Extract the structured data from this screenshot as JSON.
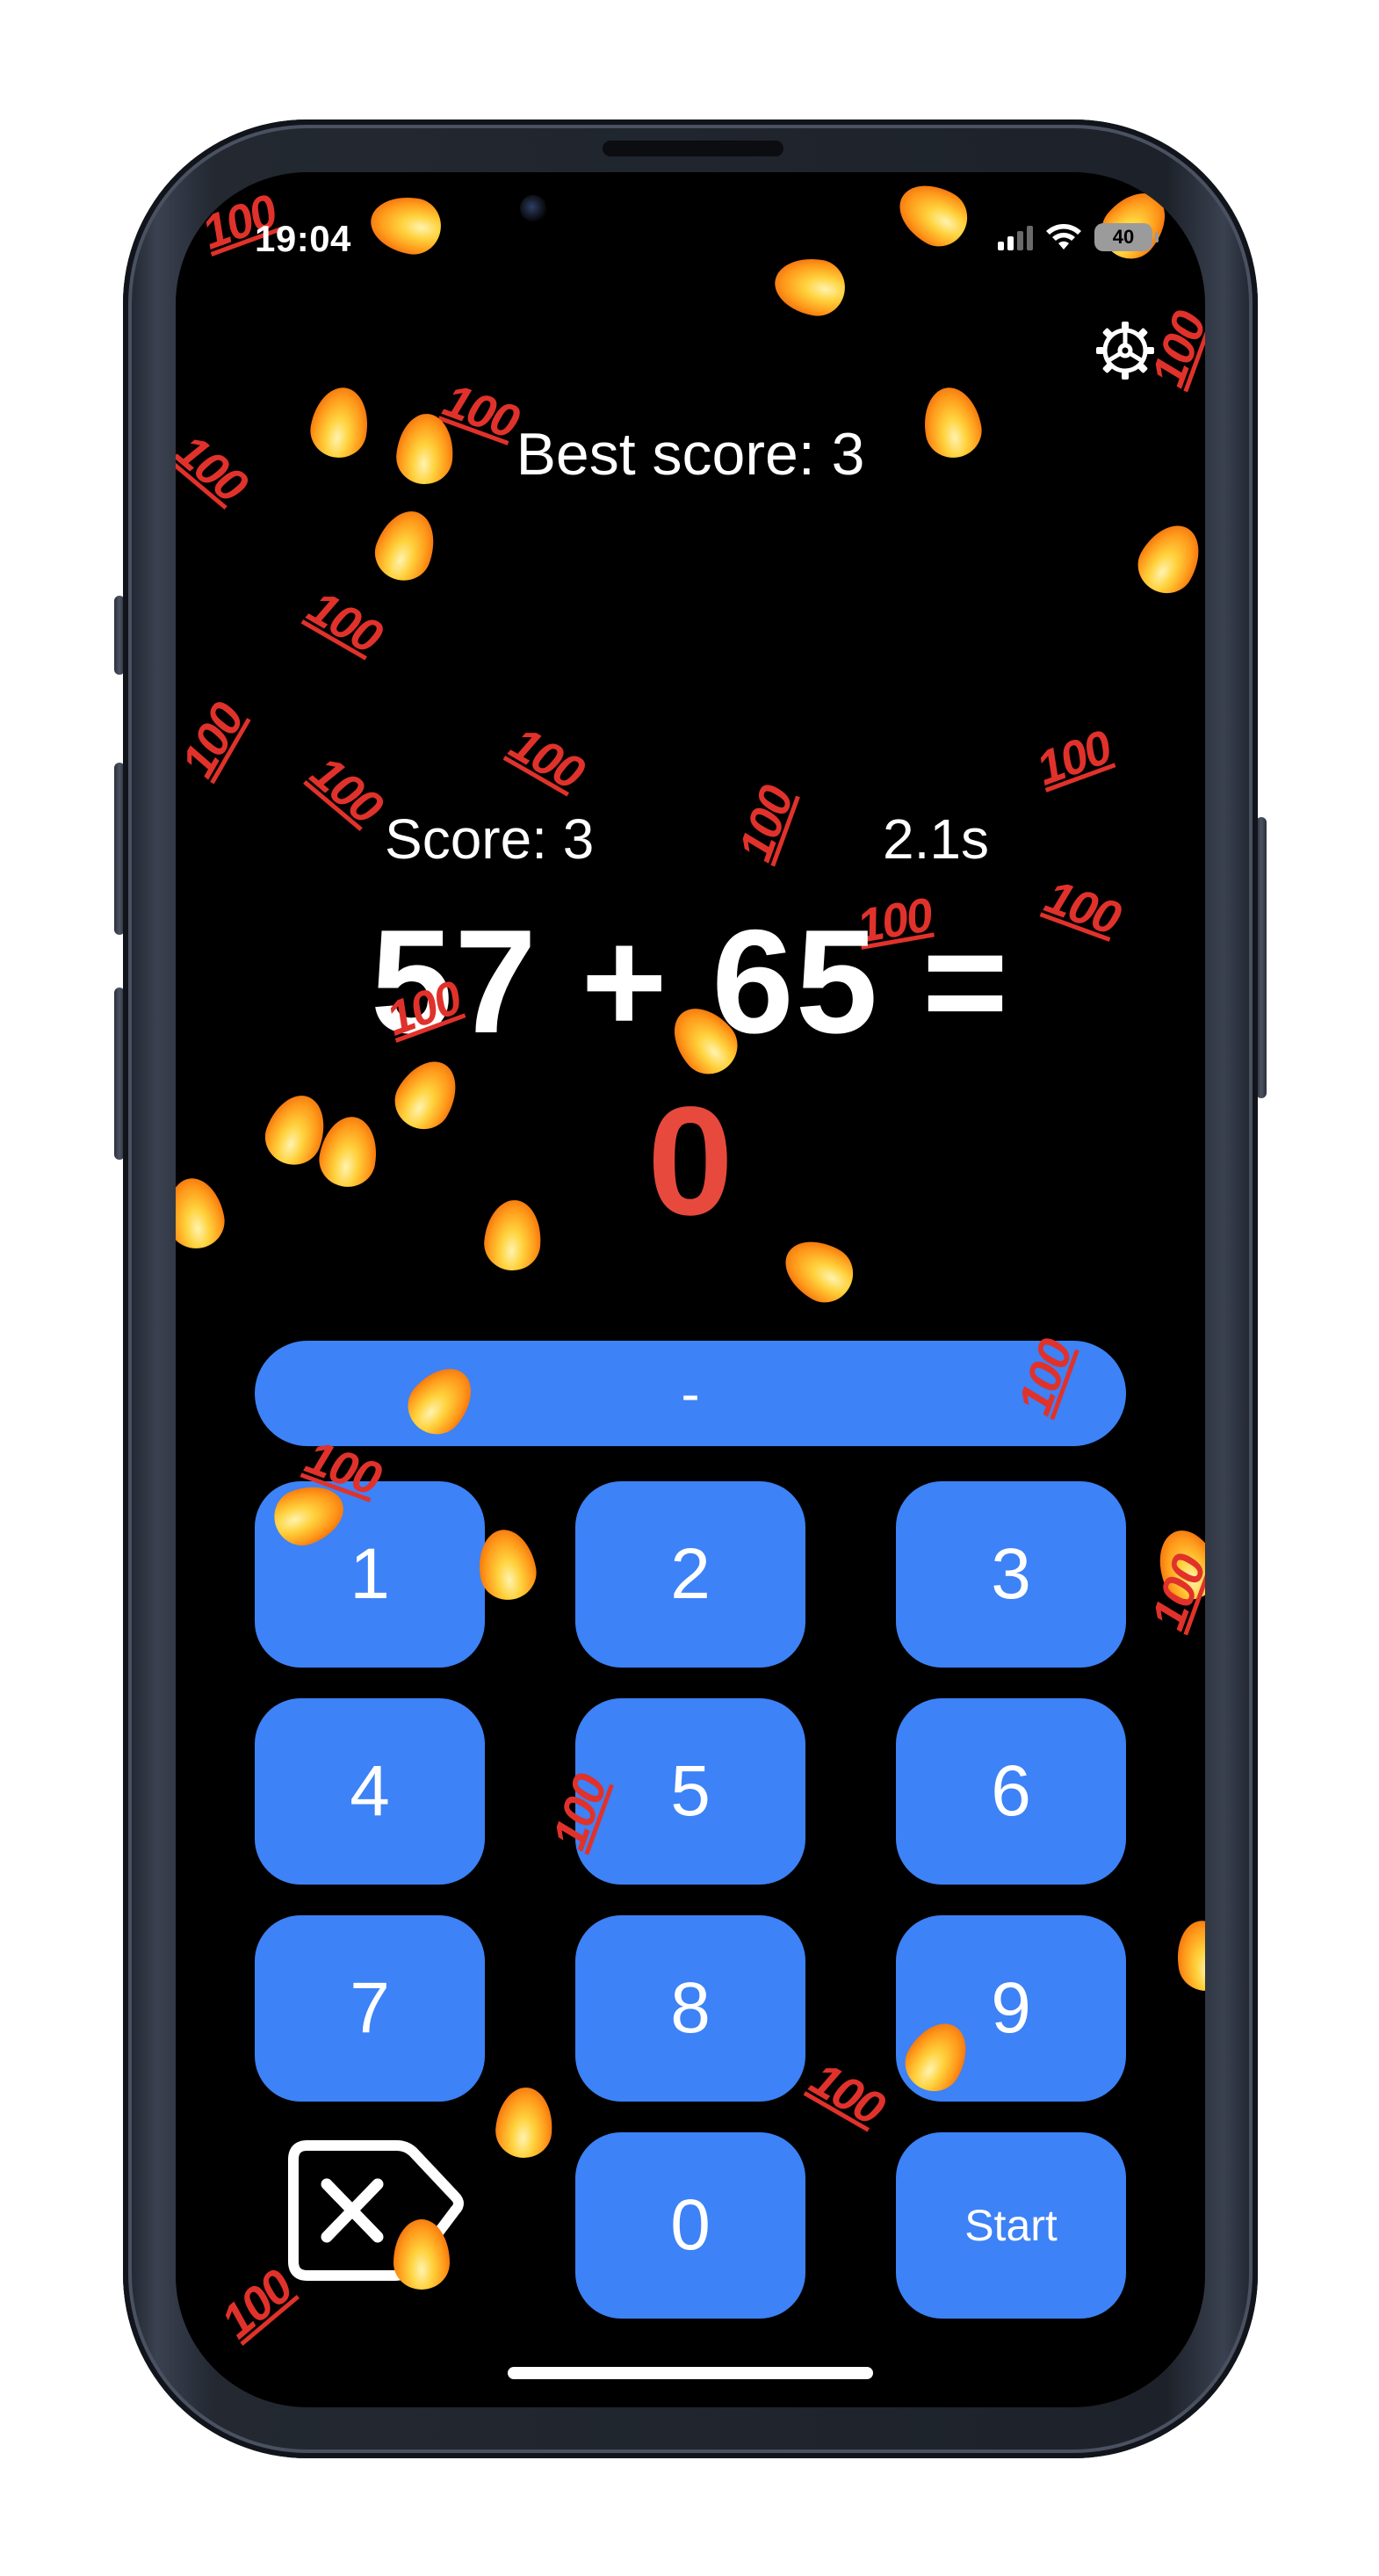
{
  "status_bar": {
    "time": "19:04",
    "battery": "40",
    "icons": [
      "cellular-signal-icon",
      "wifi-icon",
      "battery-icon"
    ]
  },
  "header": {
    "settings_icon": "gear-icon",
    "best_score": "Best score: 3"
  },
  "game": {
    "score": "Score: 3",
    "timer": "2.1s",
    "equation": "57 + 65 =",
    "answer": "0",
    "answer_color": "#e8493d"
  },
  "keypad": {
    "sign_label": "-",
    "keys": [
      "1",
      "2",
      "3",
      "4",
      "5",
      "6",
      "7",
      "8",
      "9"
    ],
    "zero": "0",
    "start": "Start",
    "backspace_icon": "backspace-icon",
    "accent_color": "#3d82f6"
  },
  "decorations": {
    "emoji": [
      "fire-emoji",
      "hundred-points-emoji"
    ],
    "hundred_text": "100"
  }
}
